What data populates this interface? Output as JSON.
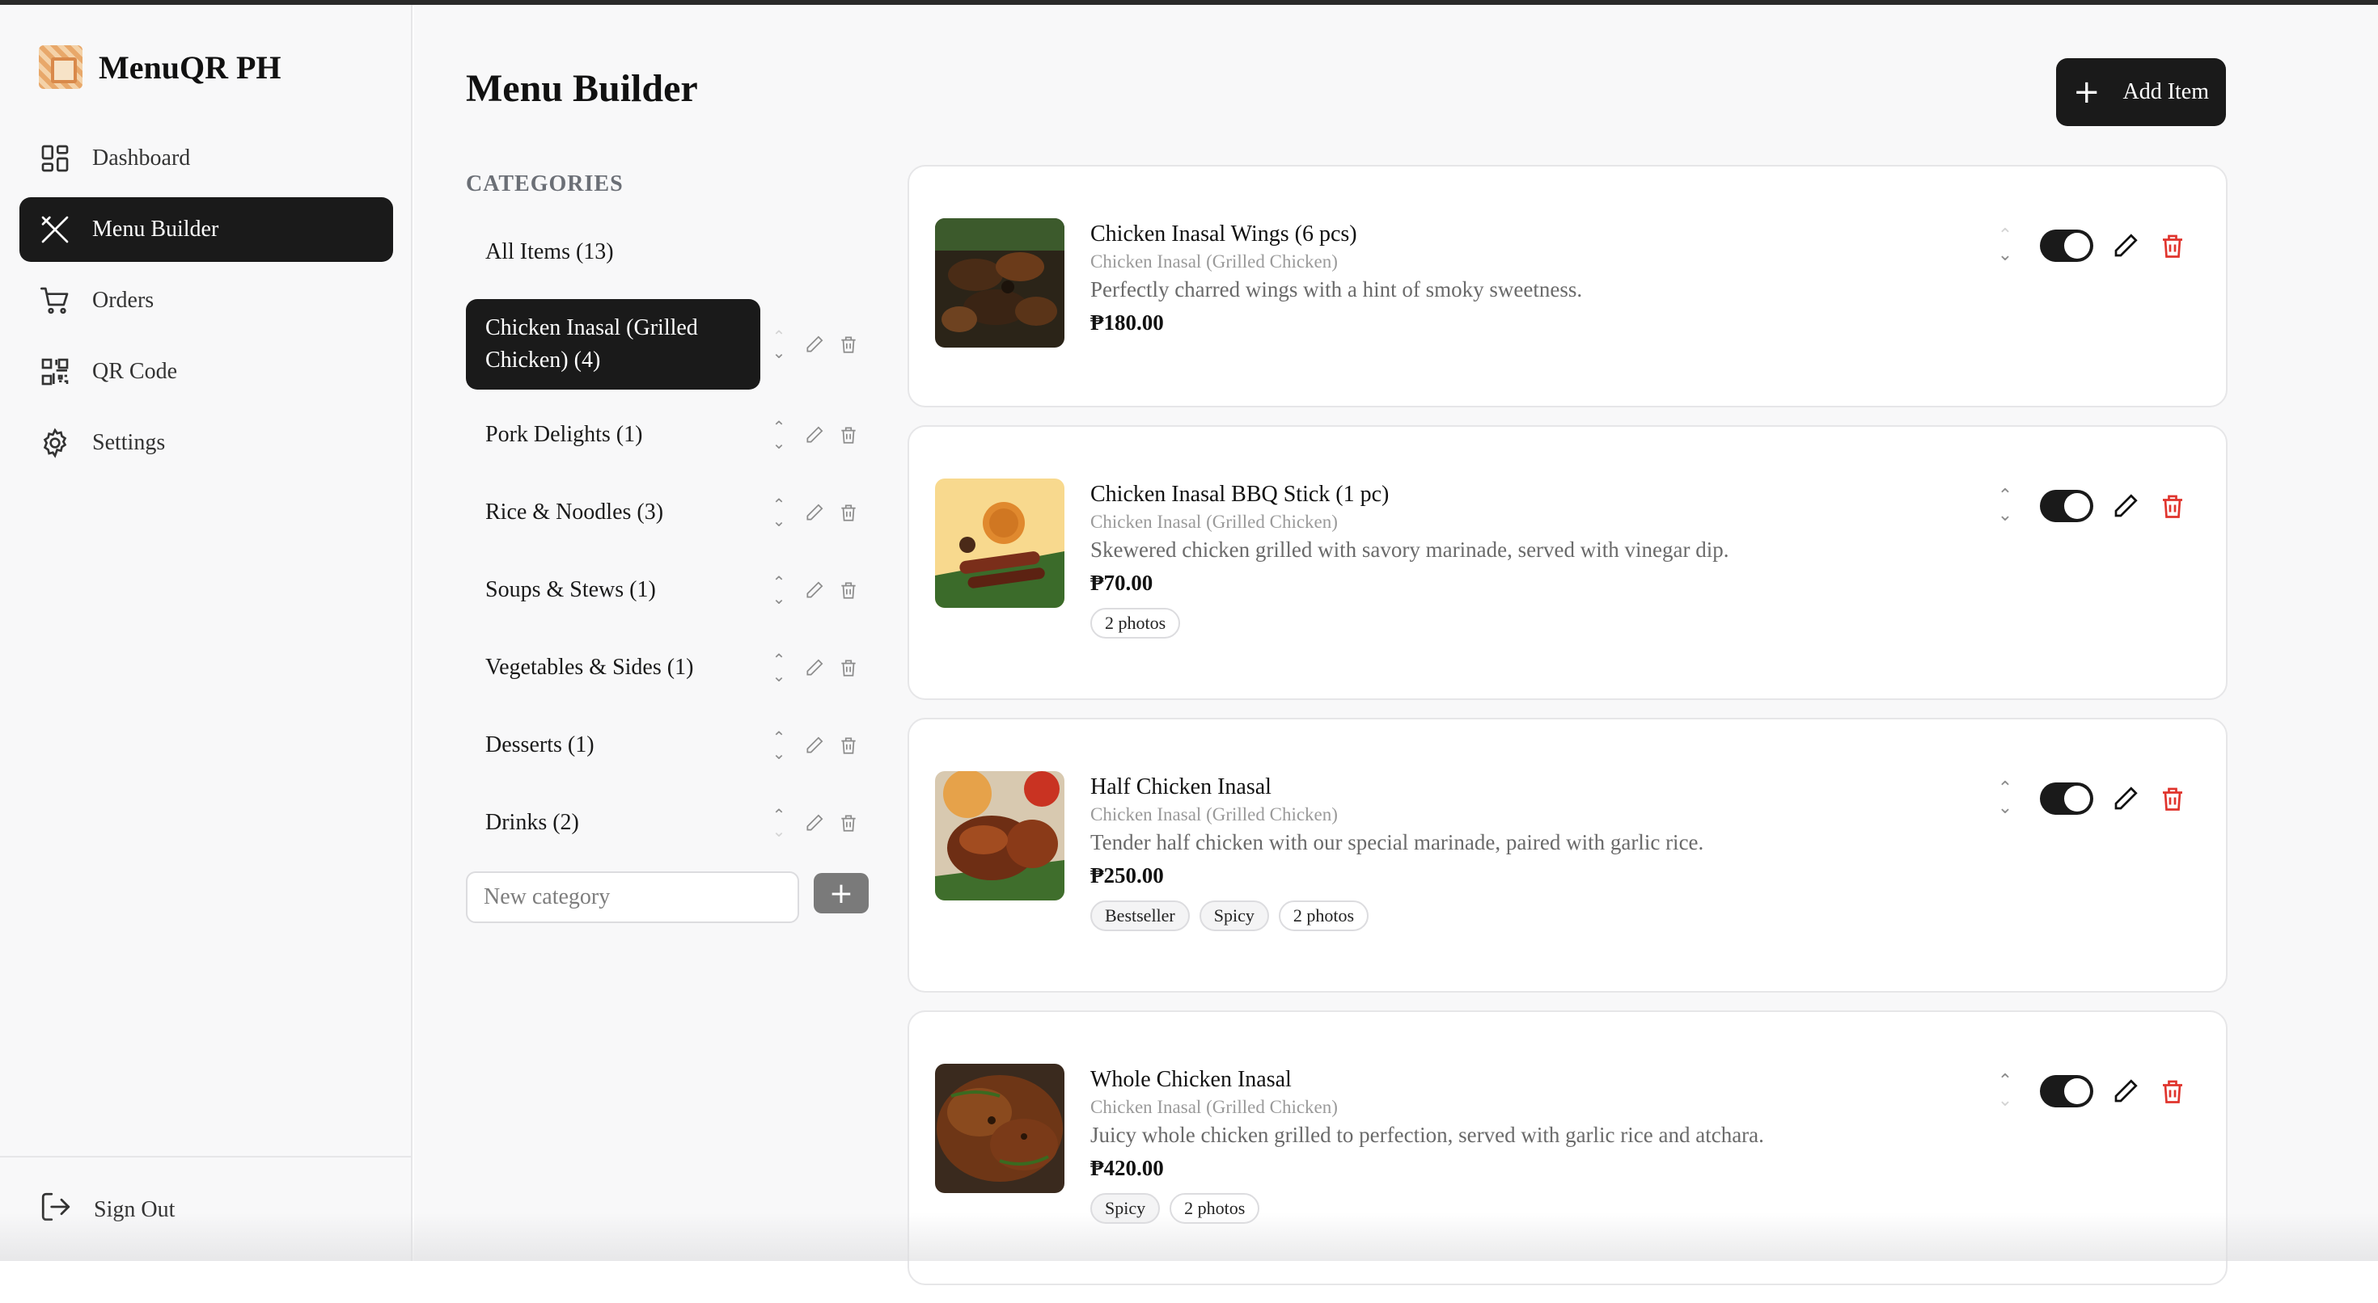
{
  "app": {
    "name": "MenuQR PH"
  },
  "sidebar": {
    "items": [
      {
        "label": "Dashboard",
        "icon": "dashboard-icon"
      },
      {
        "label": "Menu Builder",
        "icon": "utensils-icon",
        "active": true
      },
      {
        "label": "Orders",
        "icon": "cart-icon"
      },
      {
        "label": "QR Code",
        "icon": "qr-code-icon"
      },
      {
        "label": "Settings",
        "icon": "gear-icon"
      }
    ],
    "signout_label": "Sign Out"
  },
  "main": {
    "title": "Menu Builder",
    "add_item_label": "Add Item",
    "categories_heading": "CATEGORIES",
    "categories": [
      {
        "label": "All Items (13)"
      },
      {
        "label": "Chicken Inasal (Grilled Chicken) (4)",
        "active": true
      },
      {
        "label": "Pork Delights (1)"
      },
      {
        "label": "Rice & Noodles (3)"
      },
      {
        "label": "Soups & Stews (1)"
      },
      {
        "label": "Vegetables & Sides (1)"
      },
      {
        "label": "Desserts (1)"
      },
      {
        "label": "Drinks (2)"
      }
    ],
    "new_category_placeholder": "New category",
    "new_category_add": "+",
    "items": [
      {
        "name": "Chicken Inasal Wings (6 pcs)",
        "category": "Chicken Inasal (Grilled Chicken)",
        "description": "Perfectly charred wings with a hint of smoky sweetness.",
        "price": "₱180.00",
        "tags": [],
        "enabled": true
      },
      {
        "name": "Chicken Inasal BBQ Stick (1 pc)",
        "category": "Chicken Inasal (Grilled Chicken)",
        "description": "Skewered chicken grilled with savory marinade, served with vinegar dip.",
        "price": "₱70.00",
        "tags": [
          "2 photos"
        ],
        "enabled": true
      },
      {
        "name": "Half Chicken Inasal",
        "category": "Chicken Inasal (Grilled Chicken)",
        "description": "Tender half chicken with our special marinade, paired with garlic rice.",
        "price": "₱250.00",
        "tags": [
          "Bestseller",
          "Spicy",
          "2 photos"
        ],
        "enabled": true
      },
      {
        "name": "Whole Chicken Inasal",
        "category": "Chicken Inasal (Grilled Chicken)",
        "description": "Juicy whole chicken grilled to perfection, served with garlic rice and atchara.",
        "price": "₱420.00",
        "tags": [
          "Spicy",
          "2 photos"
        ],
        "enabled": true
      }
    ]
  },
  "colors": {
    "accent": "#1a1a1a",
    "danger": "#e0342d",
    "muted": "#9a9a9a"
  }
}
